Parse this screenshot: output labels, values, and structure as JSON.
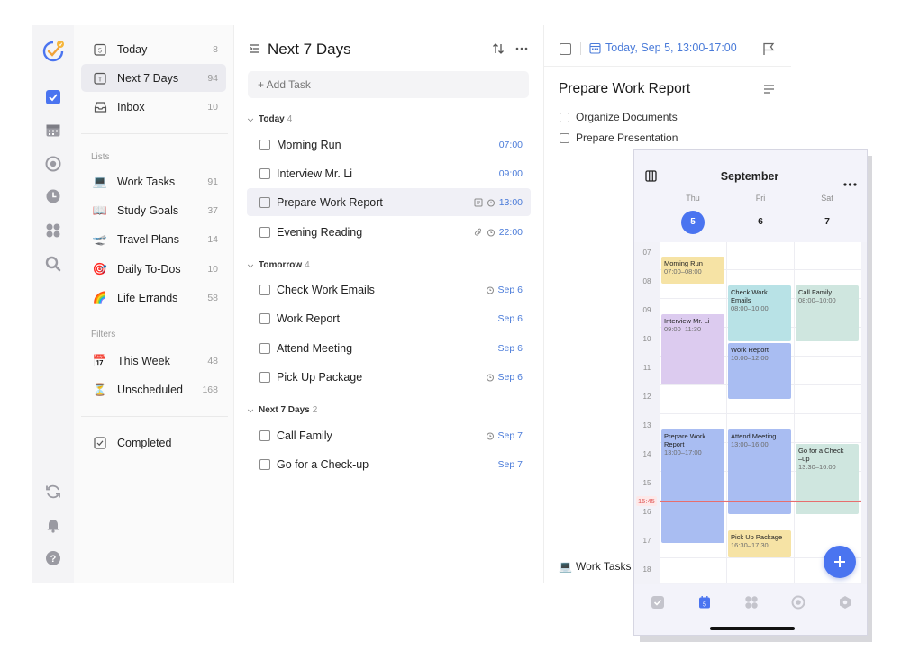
{
  "colors": {
    "accent": "#4a74f0",
    "link": "#4a7bd9",
    "now": "#e05555"
  },
  "rail": {
    "icons": [
      "avatar-icon",
      "task-check-icon",
      "calendar-grid-icon",
      "focus-circle-icon",
      "clock-icon",
      "apps-grid-icon",
      "search-icon",
      "sync-icon",
      "bell-icon",
      "help-icon"
    ]
  },
  "sidebar": {
    "smart": [
      {
        "label": "Today",
        "count": "8",
        "icon": "calendar-day-icon"
      },
      {
        "label": "Next 7 Days",
        "count": "94",
        "icon": "calendar-week-icon"
      },
      {
        "label": "Inbox",
        "count": "10",
        "icon": "inbox-icon"
      }
    ],
    "lists_heading": "Lists",
    "lists": [
      {
        "emoji": "💻",
        "label": "Work Tasks",
        "count": "91"
      },
      {
        "emoji": "📖",
        "label": "Study Goals",
        "count": "37"
      },
      {
        "emoji": "🛫",
        "label": "Travel Plans",
        "count": "14"
      },
      {
        "emoji": "🎯",
        "label": "Daily To-Dos",
        "count": "10"
      },
      {
        "emoji": "🌈",
        "label": "Life Errands",
        "count": "58"
      }
    ],
    "filters_heading": "Filters",
    "filters": [
      {
        "emoji": "📅",
        "label": "This Week",
        "count": "48"
      },
      {
        "emoji": "⏳",
        "label": "Unscheduled",
        "count": "168"
      }
    ],
    "completed": "Completed"
  },
  "tasklist": {
    "title": "Next 7 Days",
    "add_placeholder": "+ Add Task",
    "groups": [
      {
        "label": "Today",
        "count": "4"
      },
      {
        "label": "Tomorrow",
        "count": "4"
      },
      {
        "label": "Next 7 Days",
        "count": "2"
      }
    ],
    "tasks": [
      {
        "label": "Morning Run",
        "date": "07:00"
      },
      {
        "label": "Interview Mr. Li",
        "date": "09:00"
      },
      {
        "label": "Prepare Work Report",
        "date": "13:00"
      },
      {
        "label": "Evening Reading",
        "date": "22:00"
      },
      {
        "label": "Check Work Emails",
        "date": "Sep 6"
      },
      {
        "label": "Work Report",
        "date": "Sep 6"
      },
      {
        "label": "Attend Meeting",
        "date": "Sep 6"
      },
      {
        "label": "Pick Up Package",
        "date": "Sep 6"
      },
      {
        "label": "Call Family",
        "date": "Sep 7"
      },
      {
        "label": "Go for a Check-up",
        "date": "Sep 7"
      }
    ]
  },
  "detail": {
    "date": "Today, Sep 5, 13:00-17:00",
    "title": "Prepare Work Report",
    "subtasks": [
      "Organize Documents",
      "Prepare Presentation"
    ],
    "list_emoji": "💻",
    "list_name": "Work Tasks"
  },
  "phone": {
    "month": "September",
    "days": [
      {
        "dow": "Thu",
        "num": "5"
      },
      {
        "dow": "Fri",
        "num": "6"
      },
      {
        "dow": "Sat",
        "num": "7"
      }
    ],
    "hours": [
      "07",
      "08",
      "09",
      "10",
      "11",
      "12",
      "13",
      "14",
      "15",
      "16",
      "17",
      "18"
    ],
    "now": "15:45",
    "events": [
      {
        "title": "Morning Run",
        "time": "07:00–08:00",
        "day": 0,
        "color": "#f6e3a5"
      },
      {
        "title": "Interview Mr. Li",
        "time": "09:00–11:30",
        "day": 0,
        "color": "#dccbef"
      },
      {
        "title": "Prepare Work Report",
        "time": "13:00–17:00",
        "day": 0,
        "color": "#a9bdf2"
      },
      {
        "title": "Check Work Emails",
        "time": "08:00–10:00",
        "day": 1,
        "color": "#b8e2e6"
      },
      {
        "title": "Work Report",
        "time": "10:00–12:00",
        "day": 1,
        "color": "#a9bdf2"
      },
      {
        "title": "Attend Meeting",
        "time": "13:00–16:00",
        "day": 1,
        "color": "#a9bdf2"
      },
      {
        "title": "Pick Up Package",
        "time": "16:30–17:30",
        "day": 1,
        "color": "#f6e3a5"
      },
      {
        "title": "Call Family",
        "time": "08:00–10:00",
        "day": 2,
        "color": "#cfe6df"
      },
      {
        "title": "Go for a Check\n–up",
        "time": "13:30–16:00",
        "day": 2,
        "color": "#cfe6df"
      }
    ]
  }
}
